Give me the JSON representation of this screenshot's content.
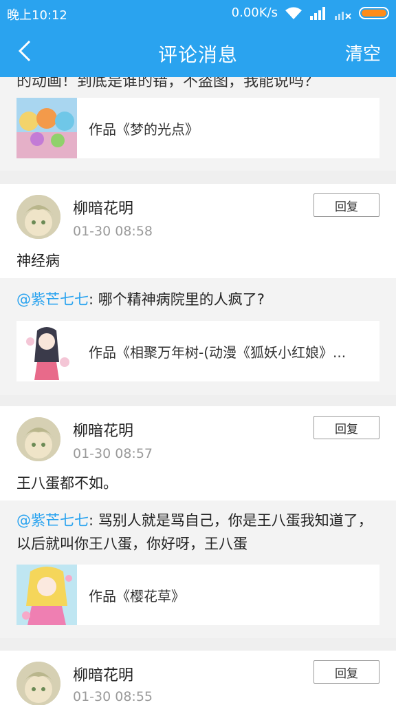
{
  "status_bar": {
    "time": "晚上10:12",
    "net_speed": "0.00K/s"
  },
  "header": {
    "title": "评论消息",
    "clear_label": "清空"
  },
  "colors": {
    "primary": "#2aa3ef",
    "mention": "#2aa3ef",
    "battery": "#ff8c1a"
  },
  "top_partial": {
    "text": "的动画！到底是谁的错，不盗图，我能说吗？",
    "work_title": "作品《梦的光点》"
  },
  "comments": [
    {
      "username": "柳暗花明",
      "time": "01-30 08:58",
      "reply_label": "回复",
      "text": "神经病",
      "quote_mention": "@紫芒七七",
      "quote_text": ": 哪个精神病院里的人疯了?",
      "work_title": "作品《相聚万年树-(动漫《狐妖小红娘》..."
    },
    {
      "username": "柳暗花明",
      "time": "01-30 08:57",
      "reply_label": "回复",
      "text": "王八蛋都不如。",
      "quote_mention": "@紫芒七七",
      "quote_text": ": 骂别人就是骂自己，你是王八蛋我知道了，以后就叫你王八蛋，你好呀，王八蛋",
      "work_title": "作品《樱花草》"
    },
    {
      "username": "柳暗花明",
      "time": "01-30 08:55",
      "reply_label": "回复"
    }
  ]
}
